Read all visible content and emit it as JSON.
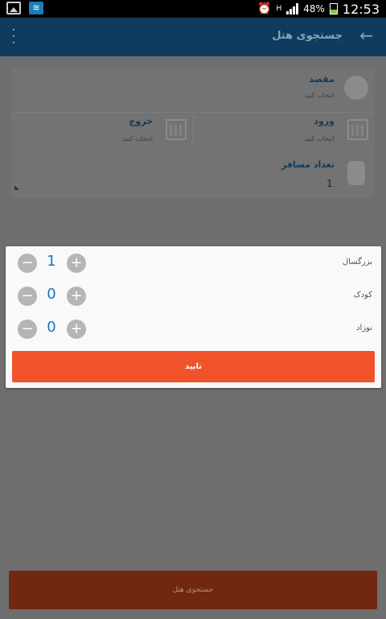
{
  "status_bar": {
    "battery": "48%",
    "time": "12:53",
    "network": "H"
  },
  "app_bar": {
    "title": "جستجوی هتل"
  },
  "form": {
    "destination": {
      "label": "مقصد",
      "hint": "انتخاب کنید"
    },
    "check_in": {
      "label": "ورود",
      "hint": "انتخاب کنید"
    },
    "check_out": {
      "label": "خروج",
      "hint": "انتخاب کنید"
    },
    "passengers": {
      "label": "تعداد مسافر",
      "value": "1"
    }
  },
  "dialog": {
    "rows": [
      {
        "label": "بزرگسال",
        "count": "1"
      },
      {
        "label": "کودک",
        "count": "0"
      },
      {
        "label": "نوزاد",
        "count": "0"
      }
    ],
    "confirm_label": "تایید",
    "minus_symbol": "−",
    "plus_symbol": "+"
  },
  "search_button_label": "جستجوی هتل",
  "colors": {
    "primary": "#0f3c5e",
    "accent": "#f0522a",
    "counter": "#1976c2"
  }
}
